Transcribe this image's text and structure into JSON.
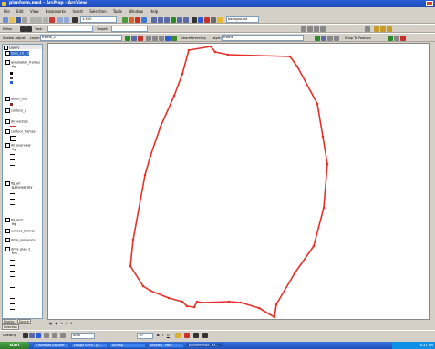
{
  "window": {
    "title": "planform.mxd - ArcMap - ArcView",
    "close_label": "X"
  },
  "menu": [
    "File",
    "Edit",
    "View",
    "Bookmarks",
    "Insert",
    "Selection",
    "Tools",
    "Window",
    "Help"
  ],
  "toolbar1": {
    "scale_value": "1:500",
    "layer_dropdown": "background"
  },
  "toolbar2": {
    "editor_label": "Editor",
    "task_label": "Task:",
    "target_label": "Target:"
  },
  "toolbar3": {
    "spatial_adjust_label": "Spatial Adjust",
    "georef_label": "Georeferencing",
    "layer_label": "Layer:",
    "layer_value": "frame_2",
    "layer2_label": "Layer:",
    "layer2_value": "frame",
    "snapping_label": "Snap To Feature"
  },
  "toc": {
    "title": "Layers",
    "items": [
      {
        "label": "lines_10_15",
        "checked": true
      },
      {
        "label": "annotation_frames",
        "checked": false
      },
      {
        "label": "fig",
        "checked": false
      },
      {
        "label": "bench_line",
        "checked": false
      },
      {
        "label": "contour_2",
        "checked": false
      },
      {
        "label": "dir_vectors",
        "checked": true
      },
      {
        "label": "contour_frames",
        "checked": true
      },
      {
        "label": "dir_overview",
        "checked": true
      },
      {
        "label": "fig",
        "checked": false
      },
      {
        "label": "fig_arr",
        "checked": true
      },
      {
        "label": "BATHYMETRY",
        "checked": false
      },
      {
        "label": "fig_grid",
        "checked": true
      },
      {
        "label": "fig",
        "checked": false
      },
      {
        "label": "surface_frames",
        "checked": false
      },
      {
        "label": "drive_sequence",
        "checked": true
      },
      {
        "label": "drive_plan_2",
        "checked": false
      },
      {
        "label": "frm",
        "checked": false
      }
    ],
    "tabs": [
      "Display",
      "Source",
      "Selection"
    ]
  },
  "map": {
    "outline_color": "#e4322b"
  },
  "mapbar": {
    "coords": "",
    "pager": "1"
  },
  "drawbar": {
    "drawing_label": "Drawing",
    "font_value": "Arial",
    "font_size": "10"
  },
  "taskbar": {
    "start_label": "start",
    "items": [
      "2 Windows Explorer",
      "Google Earth - [G...",
      "ArcMap",
      "Untitled - Paint",
      "planform.mxd - Ar..."
    ],
    "clock": "4:31 PM"
  },
  "colors": {
    "titlebar": "#1f49b8",
    "taskbar": "#2b5fc6",
    "outline": "#e4322b"
  }
}
